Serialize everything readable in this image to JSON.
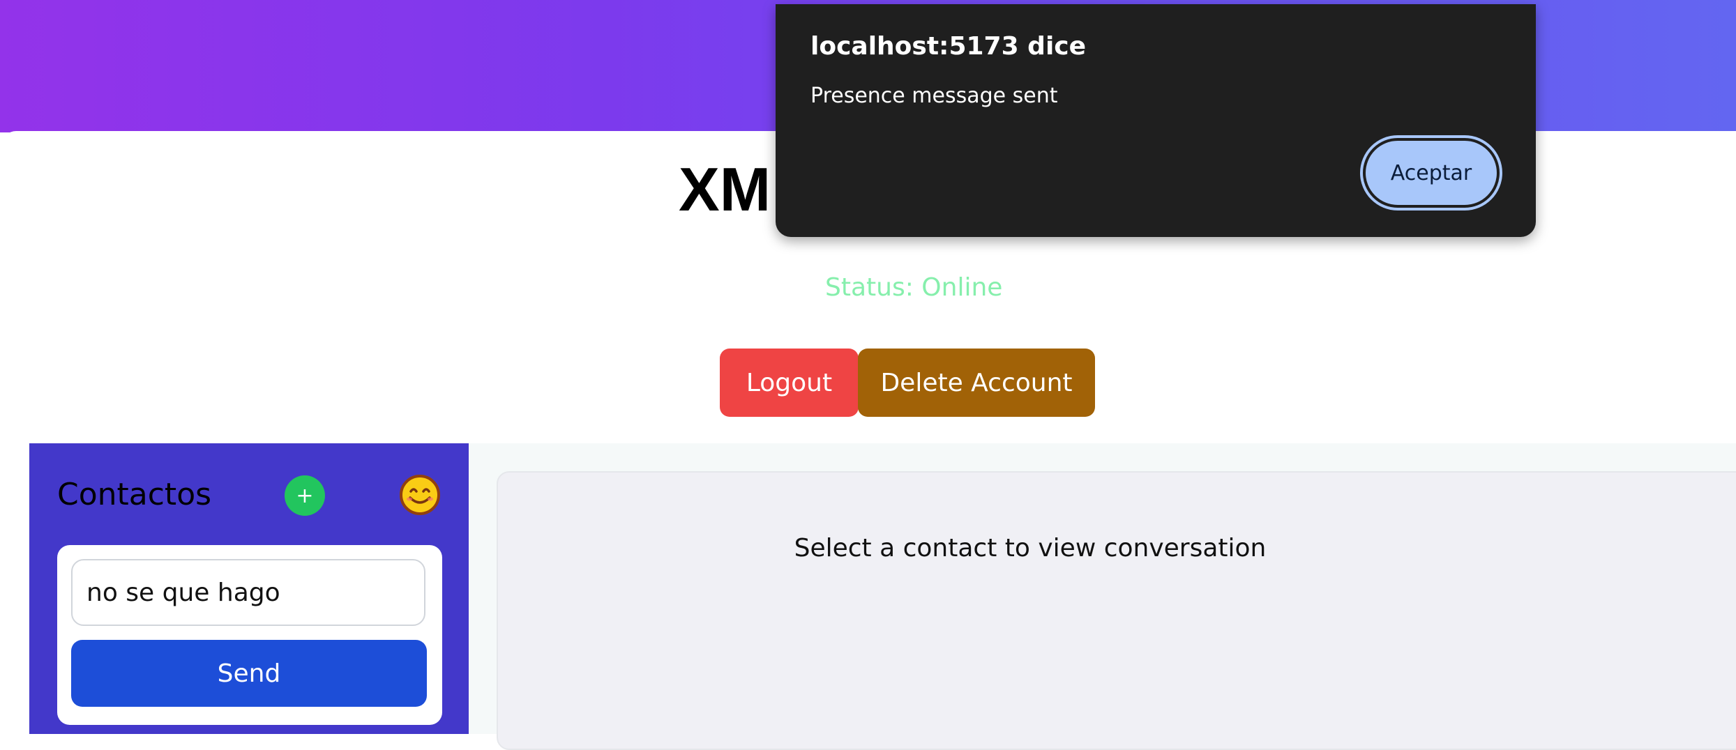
{
  "header": {
    "app_title": "XM",
    "status_text": "Status: Online"
  },
  "actions": {
    "logout_label": "Logout",
    "delete_account_label": "Delete Account"
  },
  "sidebar": {
    "title": "Contactos",
    "add_contact_label": "+",
    "presence_input_value": "no se que hago",
    "send_label": "Send"
  },
  "conversation": {
    "placeholder": "Select a contact to view conversation"
  },
  "alert": {
    "title": "localhost:5173 dice",
    "message": "Presence message sent",
    "ok_label": "Aceptar"
  },
  "colors": {
    "header_gradient_start": "#9333ea",
    "header_gradient_end": "#6366f1",
    "status_online": "#86efac",
    "logout": "#ef4444",
    "delete_account": "#a16207",
    "sidebar_bg": "#4338ca",
    "add_contact": "#22c55e",
    "send": "#1d4ed8",
    "alert_bg": "#1f1f1f",
    "alert_button": "#a8c7fa"
  },
  "icons": {
    "add_contact": "plus-icon",
    "status_picker": "smiley-icon"
  }
}
